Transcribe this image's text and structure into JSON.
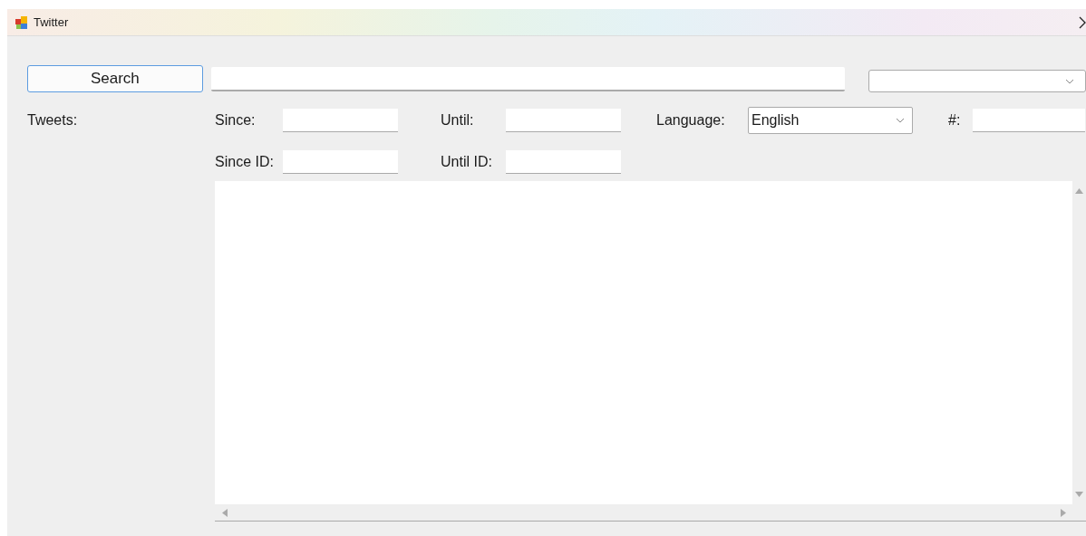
{
  "window": {
    "title": "Twitter"
  },
  "search_button": {
    "label": "Search"
  },
  "tweets_label": "Tweets:",
  "filters_row_1": [
    {
      "kind": "text",
      "label": "Since:"
    },
    {
      "kind": "text",
      "label": "Until:"
    },
    {
      "kind": "select",
      "label": "Language:",
      "value": "English"
    },
    {
      "kind": "text",
      "label": "#:"
    }
  ],
  "filters_row_2": [
    {
      "kind": "text",
      "label": "Since ID:"
    },
    {
      "kind": "text",
      "label": "Until ID:"
    }
  ]
}
